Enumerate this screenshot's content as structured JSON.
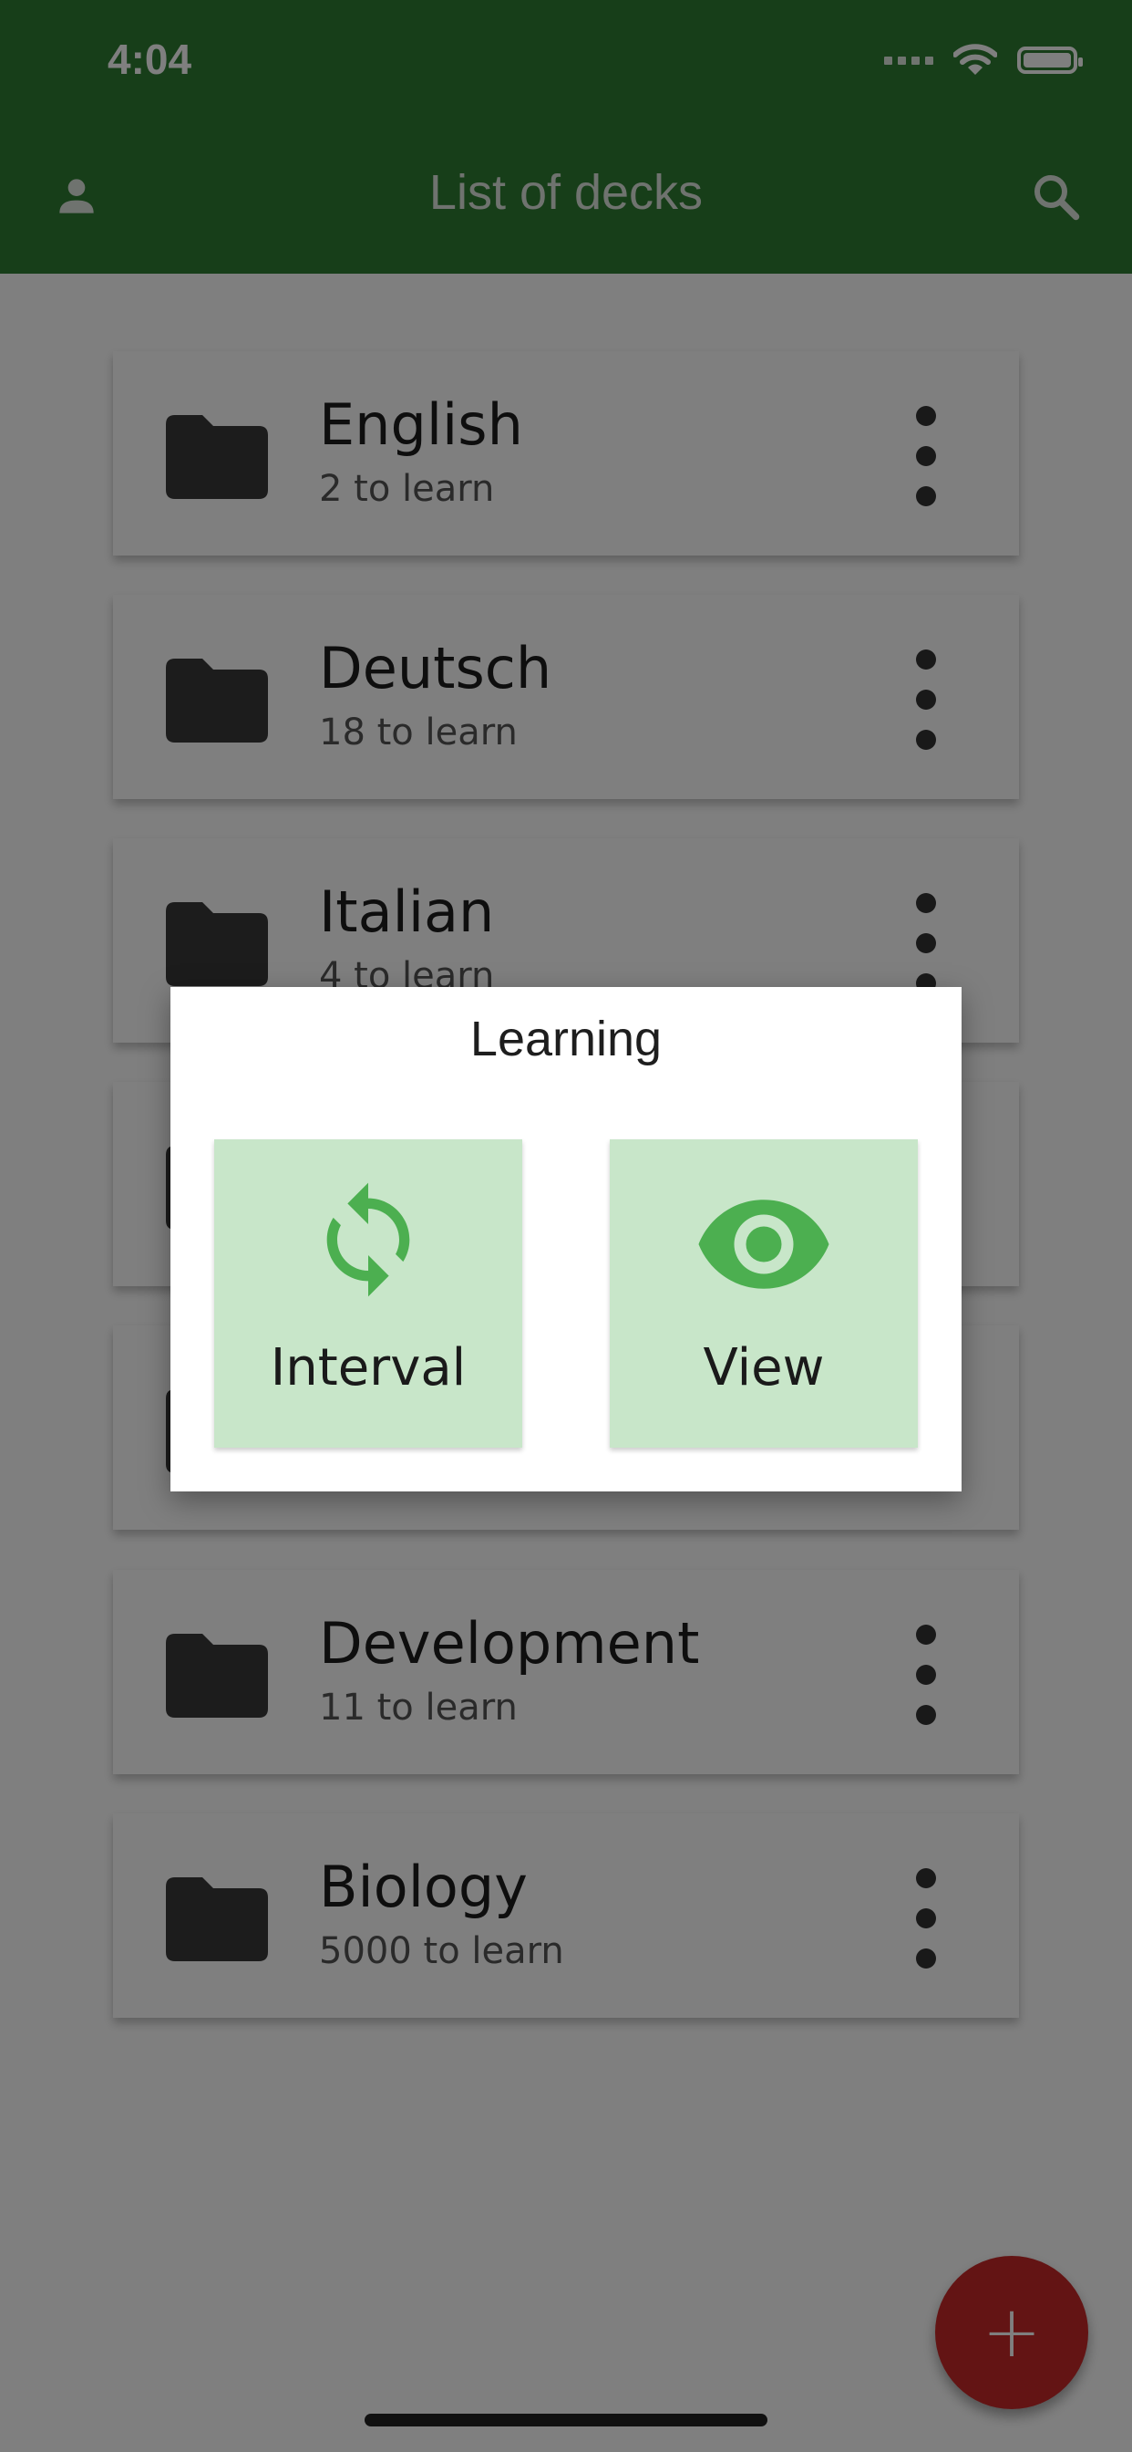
{
  "status_bar": {
    "time": "4:04"
  },
  "app_bar": {
    "title": "List of decks",
    "left_icon": "account-icon",
    "right_icon": "search-icon"
  },
  "decks": [
    {
      "name": "English",
      "subtitle": "2 to learn"
    },
    {
      "name": "Deutsch",
      "subtitle": "18 to learn"
    },
    {
      "name": "Italian",
      "subtitle": "4 to learn"
    },
    {
      "name": "",
      "subtitle": ""
    },
    {
      "name": "",
      "subtitle": ""
    },
    {
      "name": "Development",
      "subtitle": "11 to learn"
    },
    {
      "name": "Biology",
      "subtitle": "5000 to learn"
    }
  ],
  "dialog": {
    "title": "Learning",
    "options": [
      {
        "label": "Interval",
        "icon": "refresh-icon"
      },
      {
        "label": "View",
        "icon": "eye-icon"
      }
    ]
  },
  "fab": {
    "label": "+"
  },
  "colors": {
    "app_bar": "#2e7d32",
    "option_bg": "#c8e6c9",
    "option_icon": "#4caf50",
    "fab": "#c62828"
  }
}
